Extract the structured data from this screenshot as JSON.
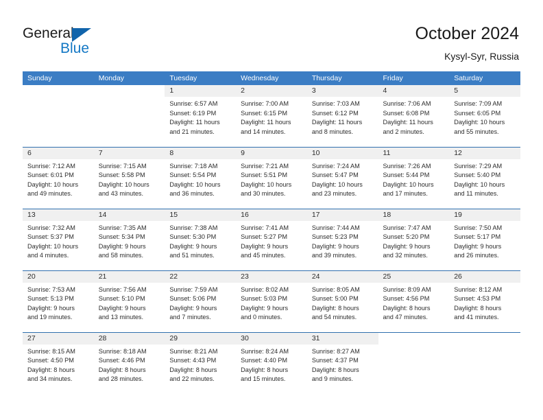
{
  "brand": {
    "name_part1": "General",
    "name_part2": "Blue",
    "triangle_color": "#1164ab",
    "blue_color": "#1277c4"
  },
  "header": {
    "month_title": "October 2024",
    "location": "Kysyl-Syr, Russia"
  },
  "theme": {
    "header_row_bg": "#3b7dc4",
    "daynum_bg": "#f0f0f0",
    "row_border": "#2f6fae",
    "text": "#2b2b2b"
  },
  "weekdays": [
    "Sunday",
    "Monday",
    "Tuesday",
    "Wednesday",
    "Thursday",
    "Friday",
    "Saturday"
  ],
  "weeks": [
    [
      {
        "day": "",
        "l1": "",
        "l2": "",
        "l3": "",
        "l4": "",
        "blank": true
      },
      {
        "day": "",
        "l1": "",
        "l2": "",
        "l3": "",
        "l4": "",
        "blank": true
      },
      {
        "day": "1",
        "l1": "Sunrise: 6:57 AM",
        "l2": "Sunset: 6:19 PM",
        "l3": "Daylight: 11 hours",
        "l4": "and 21 minutes."
      },
      {
        "day": "2",
        "l1": "Sunrise: 7:00 AM",
        "l2": "Sunset: 6:15 PM",
        "l3": "Daylight: 11 hours",
        "l4": "and 14 minutes."
      },
      {
        "day": "3",
        "l1": "Sunrise: 7:03 AM",
        "l2": "Sunset: 6:12 PM",
        "l3": "Daylight: 11 hours",
        "l4": "and 8 minutes."
      },
      {
        "day": "4",
        "l1": "Sunrise: 7:06 AM",
        "l2": "Sunset: 6:08 PM",
        "l3": "Daylight: 11 hours",
        "l4": "and 2 minutes."
      },
      {
        "day": "5",
        "l1": "Sunrise: 7:09 AM",
        "l2": "Sunset: 6:05 PM",
        "l3": "Daylight: 10 hours",
        "l4": "and 55 minutes."
      }
    ],
    [
      {
        "day": "6",
        "l1": "Sunrise: 7:12 AM",
        "l2": "Sunset: 6:01 PM",
        "l3": "Daylight: 10 hours",
        "l4": "and 49 minutes."
      },
      {
        "day": "7",
        "l1": "Sunrise: 7:15 AM",
        "l2": "Sunset: 5:58 PM",
        "l3": "Daylight: 10 hours",
        "l4": "and 43 minutes."
      },
      {
        "day": "8",
        "l1": "Sunrise: 7:18 AM",
        "l2": "Sunset: 5:54 PM",
        "l3": "Daylight: 10 hours",
        "l4": "and 36 minutes."
      },
      {
        "day": "9",
        "l1": "Sunrise: 7:21 AM",
        "l2": "Sunset: 5:51 PM",
        "l3": "Daylight: 10 hours",
        "l4": "and 30 minutes."
      },
      {
        "day": "10",
        "l1": "Sunrise: 7:24 AM",
        "l2": "Sunset: 5:47 PM",
        "l3": "Daylight: 10 hours",
        "l4": "and 23 minutes."
      },
      {
        "day": "11",
        "l1": "Sunrise: 7:26 AM",
        "l2": "Sunset: 5:44 PM",
        "l3": "Daylight: 10 hours",
        "l4": "and 17 minutes."
      },
      {
        "day": "12",
        "l1": "Sunrise: 7:29 AM",
        "l2": "Sunset: 5:40 PM",
        "l3": "Daylight: 10 hours",
        "l4": "and 11 minutes."
      }
    ],
    [
      {
        "day": "13",
        "l1": "Sunrise: 7:32 AM",
        "l2": "Sunset: 5:37 PM",
        "l3": "Daylight: 10 hours",
        "l4": "and 4 minutes."
      },
      {
        "day": "14",
        "l1": "Sunrise: 7:35 AM",
        "l2": "Sunset: 5:34 PM",
        "l3": "Daylight: 9 hours",
        "l4": "and 58 minutes."
      },
      {
        "day": "15",
        "l1": "Sunrise: 7:38 AM",
        "l2": "Sunset: 5:30 PM",
        "l3": "Daylight: 9 hours",
        "l4": "and 51 minutes."
      },
      {
        "day": "16",
        "l1": "Sunrise: 7:41 AM",
        "l2": "Sunset: 5:27 PM",
        "l3": "Daylight: 9 hours",
        "l4": "and 45 minutes."
      },
      {
        "day": "17",
        "l1": "Sunrise: 7:44 AM",
        "l2": "Sunset: 5:23 PM",
        "l3": "Daylight: 9 hours",
        "l4": "and 39 minutes."
      },
      {
        "day": "18",
        "l1": "Sunrise: 7:47 AM",
        "l2": "Sunset: 5:20 PM",
        "l3": "Daylight: 9 hours",
        "l4": "and 32 minutes."
      },
      {
        "day": "19",
        "l1": "Sunrise: 7:50 AM",
        "l2": "Sunset: 5:17 PM",
        "l3": "Daylight: 9 hours",
        "l4": "and 26 minutes."
      }
    ],
    [
      {
        "day": "20",
        "l1": "Sunrise: 7:53 AM",
        "l2": "Sunset: 5:13 PM",
        "l3": "Daylight: 9 hours",
        "l4": "and 19 minutes."
      },
      {
        "day": "21",
        "l1": "Sunrise: 7:56 AM",
        "l2": "Sunset: 5:10 PM",
        "l3": "Daylight: 9 hours",
        "l4": "and 13 minutes."
      },
      {
        "day": "22",
        "l1": "Sunrise: 7:59 AM",
        "l2": "Sunset: 5:06 PM",
        "l3": "Daylight: 9 hours",
        "l4": "and 7 minutes."
      },
      {
        "day": "23",
        "l1": "Sunrise: 8:02 AM",
        "l2": "Sunset: 5:03 PM",
        "l3": "Daylight: 9 hours",
        "l4": "and 0 minutes."
      },
      {
        "day": "24",
        "l1": "Sunrise: 8:05 AM",
        "l2": "Sunset: 5:00 PM",
        "l3": "Daylight: 8 hours",
        "l4": "and 54 minutes."
      },
      {
        "day": "25",
        "l1": "Sunrise: 8:09 AM",
        "l2": "Sunset: 4:56 PM",
        "l3": "Daylight: 8 hours",
        "l4": "and 47 minutes."
      },
      {
        "day": "26",
        "l1": "Sunrise: 8:12 AM",
        "l2": "Sunset: 4:53 PM",
        "l3": "Daylight: 8 hours",
        "l4": "and 41 minutes."
      }
    ],
    [
      {
        "day": "27",
        "l1": "Sunrise: 8:15 AM",
        "l2": "Sunset: 4:50 PM",
        "l3": "Daylight: 8 hours",
        "l4": "and 34 minutes."
      },
      {
        "day": "28",
        "l1": "Sunrise: 8:18 AM",
        "l2": "Sunset: 4:46 PM",
        "l3": "Daylight: 8 hours",
        "l4": "and 28 minutes."
      },
      {
        "day": "29",
        "l1": "Sunrise: 8:21 AM",
        "l2": "Sunset: 4:43 PM",
        "l3": "Daylight: 8 hours",
        "l4": "and 22 minutes."
      },
      {
        "day": "30",
        "l1": "Sunrise: 8:24 AM",
        "l2": "Sunset: 4:40 PM",
        "l3": "Daylight: 8 hours",
        "l4": "and 15 minutes."
      },
      {
        "day": "31",
        "l1": "Sunrise: 8:27 AM",
        "l2": "Sunset: 4:37 PM",
        "l3": "Daylight: 8 hours",
        "l4": "and 9 minutes."
      },
      {
        "day": "",
        "l1": "",
        "l2": "",
        "l3": "",
        "l4": "",
        "blank": true
      },
      {
        "day": "",
        "l1": "",
        "l2": "",
        "l3": "",
        "l4": "",
        "blank": true
      }
    ]
  ]
}
